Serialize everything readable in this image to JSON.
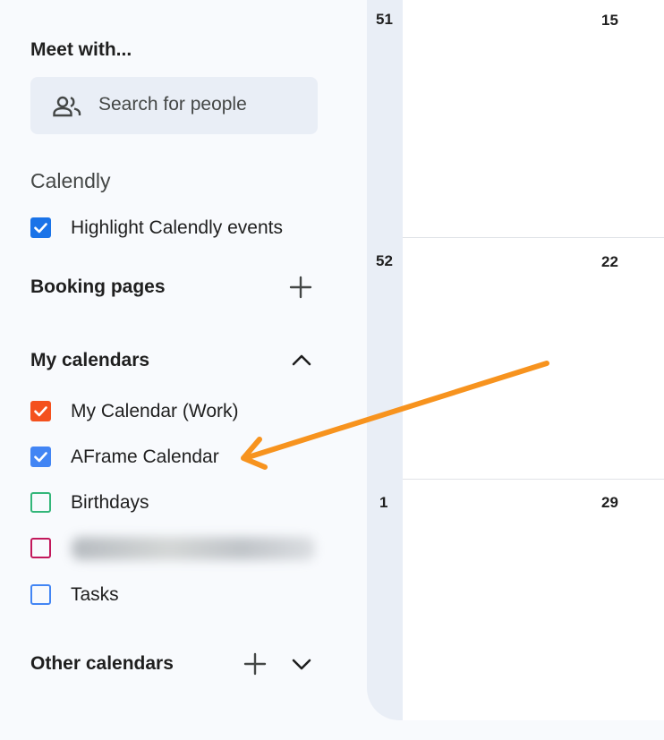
{
  "sidebar": {
    "meet_with": {
      "title": "Meet with...",
      "search_placeholder": "Search for people",
      "icon": "people-icon"
    },
    "calendly": {
      "title": "Calendly",
      "highlight_label": "Highlight Calendly events",
      "highlight_checked": true
    },
    "booking_pages": {
      "title": "Booking pages",
      "add_icon": "plus-icon"
    },
    "my_calendars": {
      "title": "My calendars",
      "toggle_icon": "chevron-up-icon",
      "items": [
        {
          "label": "My Calendar (Work)",
          "checked": true,
          "color": "#f4511e"
        },
        {
          "label": "AFrame Calendar",
          "checked": true,
          "color": "#4285f4"
        },
        {
          "label": "Birthdays",
          "checked": false,
          "color": "#33b679"
        },
        {
          "label": "",
          "checked": false,
          "color": "#c2185b"
        },
        {
          "label": "Tasks",
          "checked": false,
          "color": "#4285f4"
        }
      ]
    },
    "other_calendars": {
      "title": "Other calendars",
      "add_icon": "plus-icon",
      "toggle_icon": "chevron-down-icon"
    }
  },
  "calendar_grid": {
    "rows": [
      {
        "week": "51",
        "day": "15"
      },
      {
        "week": "52",
        "day": "22"
      },
      {
        "week": "1",
        "day": "29"
      }
    ]
  },
  "annotation": {
    "arrow_color": "#f7931e"
  }
}
